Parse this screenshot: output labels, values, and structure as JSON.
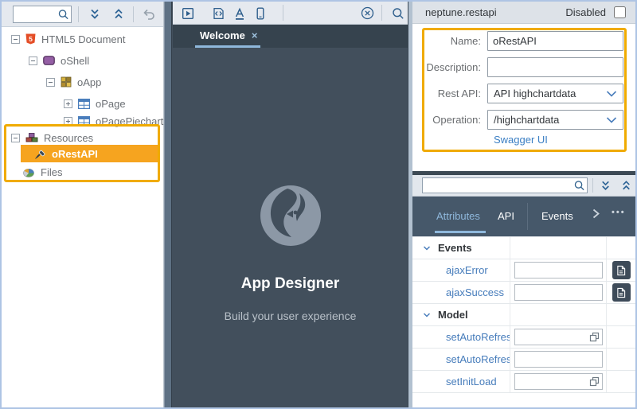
{
  "outline_panel": {
    "search": {
      "placeholder": ""
    },
    "toolbar_icons": [
      "search",
      "expand-all",
      "collapse-all",
      "undo"
    ],
    "tree": [
      {
        "label": "HTML5 Document",
        "icon": "html5",
        "expander": "minus",
        "selected": false
      },
      {
        "label": "oShell",
        "icon": "shell",
        "expander": "minus",
        "selected": false
      },
      {
        "label": "oApp",
        "icon": "app",
        "expander": "minus",
        "selected": false
      },
      {
        "label": "oPage",
        "icon": "page",
        "expander": "plus",
        "selected": false
      },
      {
        "label": "oPagePiechart",
        "icon": "page",
        "expander": "plus",
        "selected": false
      },
      {
        "label": "Resources",
        "icon": "resources",
        "expander": "minus",
        "selected": false
      },
      {
        "label": "oRestAPI",
        "icon": "brush",
        "expander": null,
        "selected": true
      },
      {
        "label": "Files",
        "icon": "files",
        "expander": null,
        "selected": false
      }
    ]
  },
  "designer": {
    "toolbar_icons": [
      "run",
      "code-file",
      "theme",
      "device",
      "close-all",
      "search"
    ],
    "tab": {
      "label": "Welcome",
      "close_glyph": "×"
    },
    "welcome": {
      "title": "App Designer",
      "subtitle": "Build your user experience"
    }
  },
  "properties": {
    "header": {
      "title": "neptune.restapi",
      "disabled_label": "Disabled",
      "disabled_checked": false
    },
    "form": {
      "fields": [
        {
          "label": "Name:",
          "value": "oRestAPI",
          "type": "input"
        },
        {
          "label": "Description:",
          "value": "",
          "type": "input"
        },
        {
          "label": "Rest API:",
          "value": "API highchartdata",
          "type": "select"
        },
        {
          "label": "Operation:",
          "value": "/highchartdata",
          "type": "select"
        }
      ],
      "link_label": "Swagger UI"
    }
  },
  "attributes_panel": {
    "search": {
      "placeholder": ""
    },
    "toolbar_icons": [
      "search",
      "expand-all",
      "collapse-all"
    ],
    "tabs": [
      {
        "label": "Attributes",
        "active": true
      },
      {
        "label": "API",
        "active": false
      },
      {
        "label": "Events",
        "active": false
      }
    ],
    "overflow_dots": "•••",
    "rows": [
      {
        "type": "group",
        "label": "Events"
      },
      {
        "type": "property",
        "label": "ajaxError",
        "value": "",
        "action": "code-editor"
      },
      {
        "type": "property",
        "label": "ajaxSuccess",
        "value": "",
        "action": "code-editor"
      },
      {
        "type": "group",
        "label": "Model"
      },
      {
        "type": "property",
        "label": "setAutoRefresh",
        "value": "",
        "action": "value-help"
      },
      {
        "type": "property",
        "label": "setAutoRefresh",
        "value": "",
        "action": "none"
      },
      {
        "type": "property",
        "label": "setInitLoad",
        "value": "",
        "action": "value-help"
      }
    ]
  },
  "icons": {
    "html5_glyph": "5"
  },
  "colors": {
    "accent_orange": "#f0ab00",
    "selection_orange": "#f6a41f",
    "link_blue": "#3b7fc4",
    "property_blue": "#467cbb",
    "dark_slate": "#424f5c",
    "tabbar_slate": "#46586a"
  }
}
